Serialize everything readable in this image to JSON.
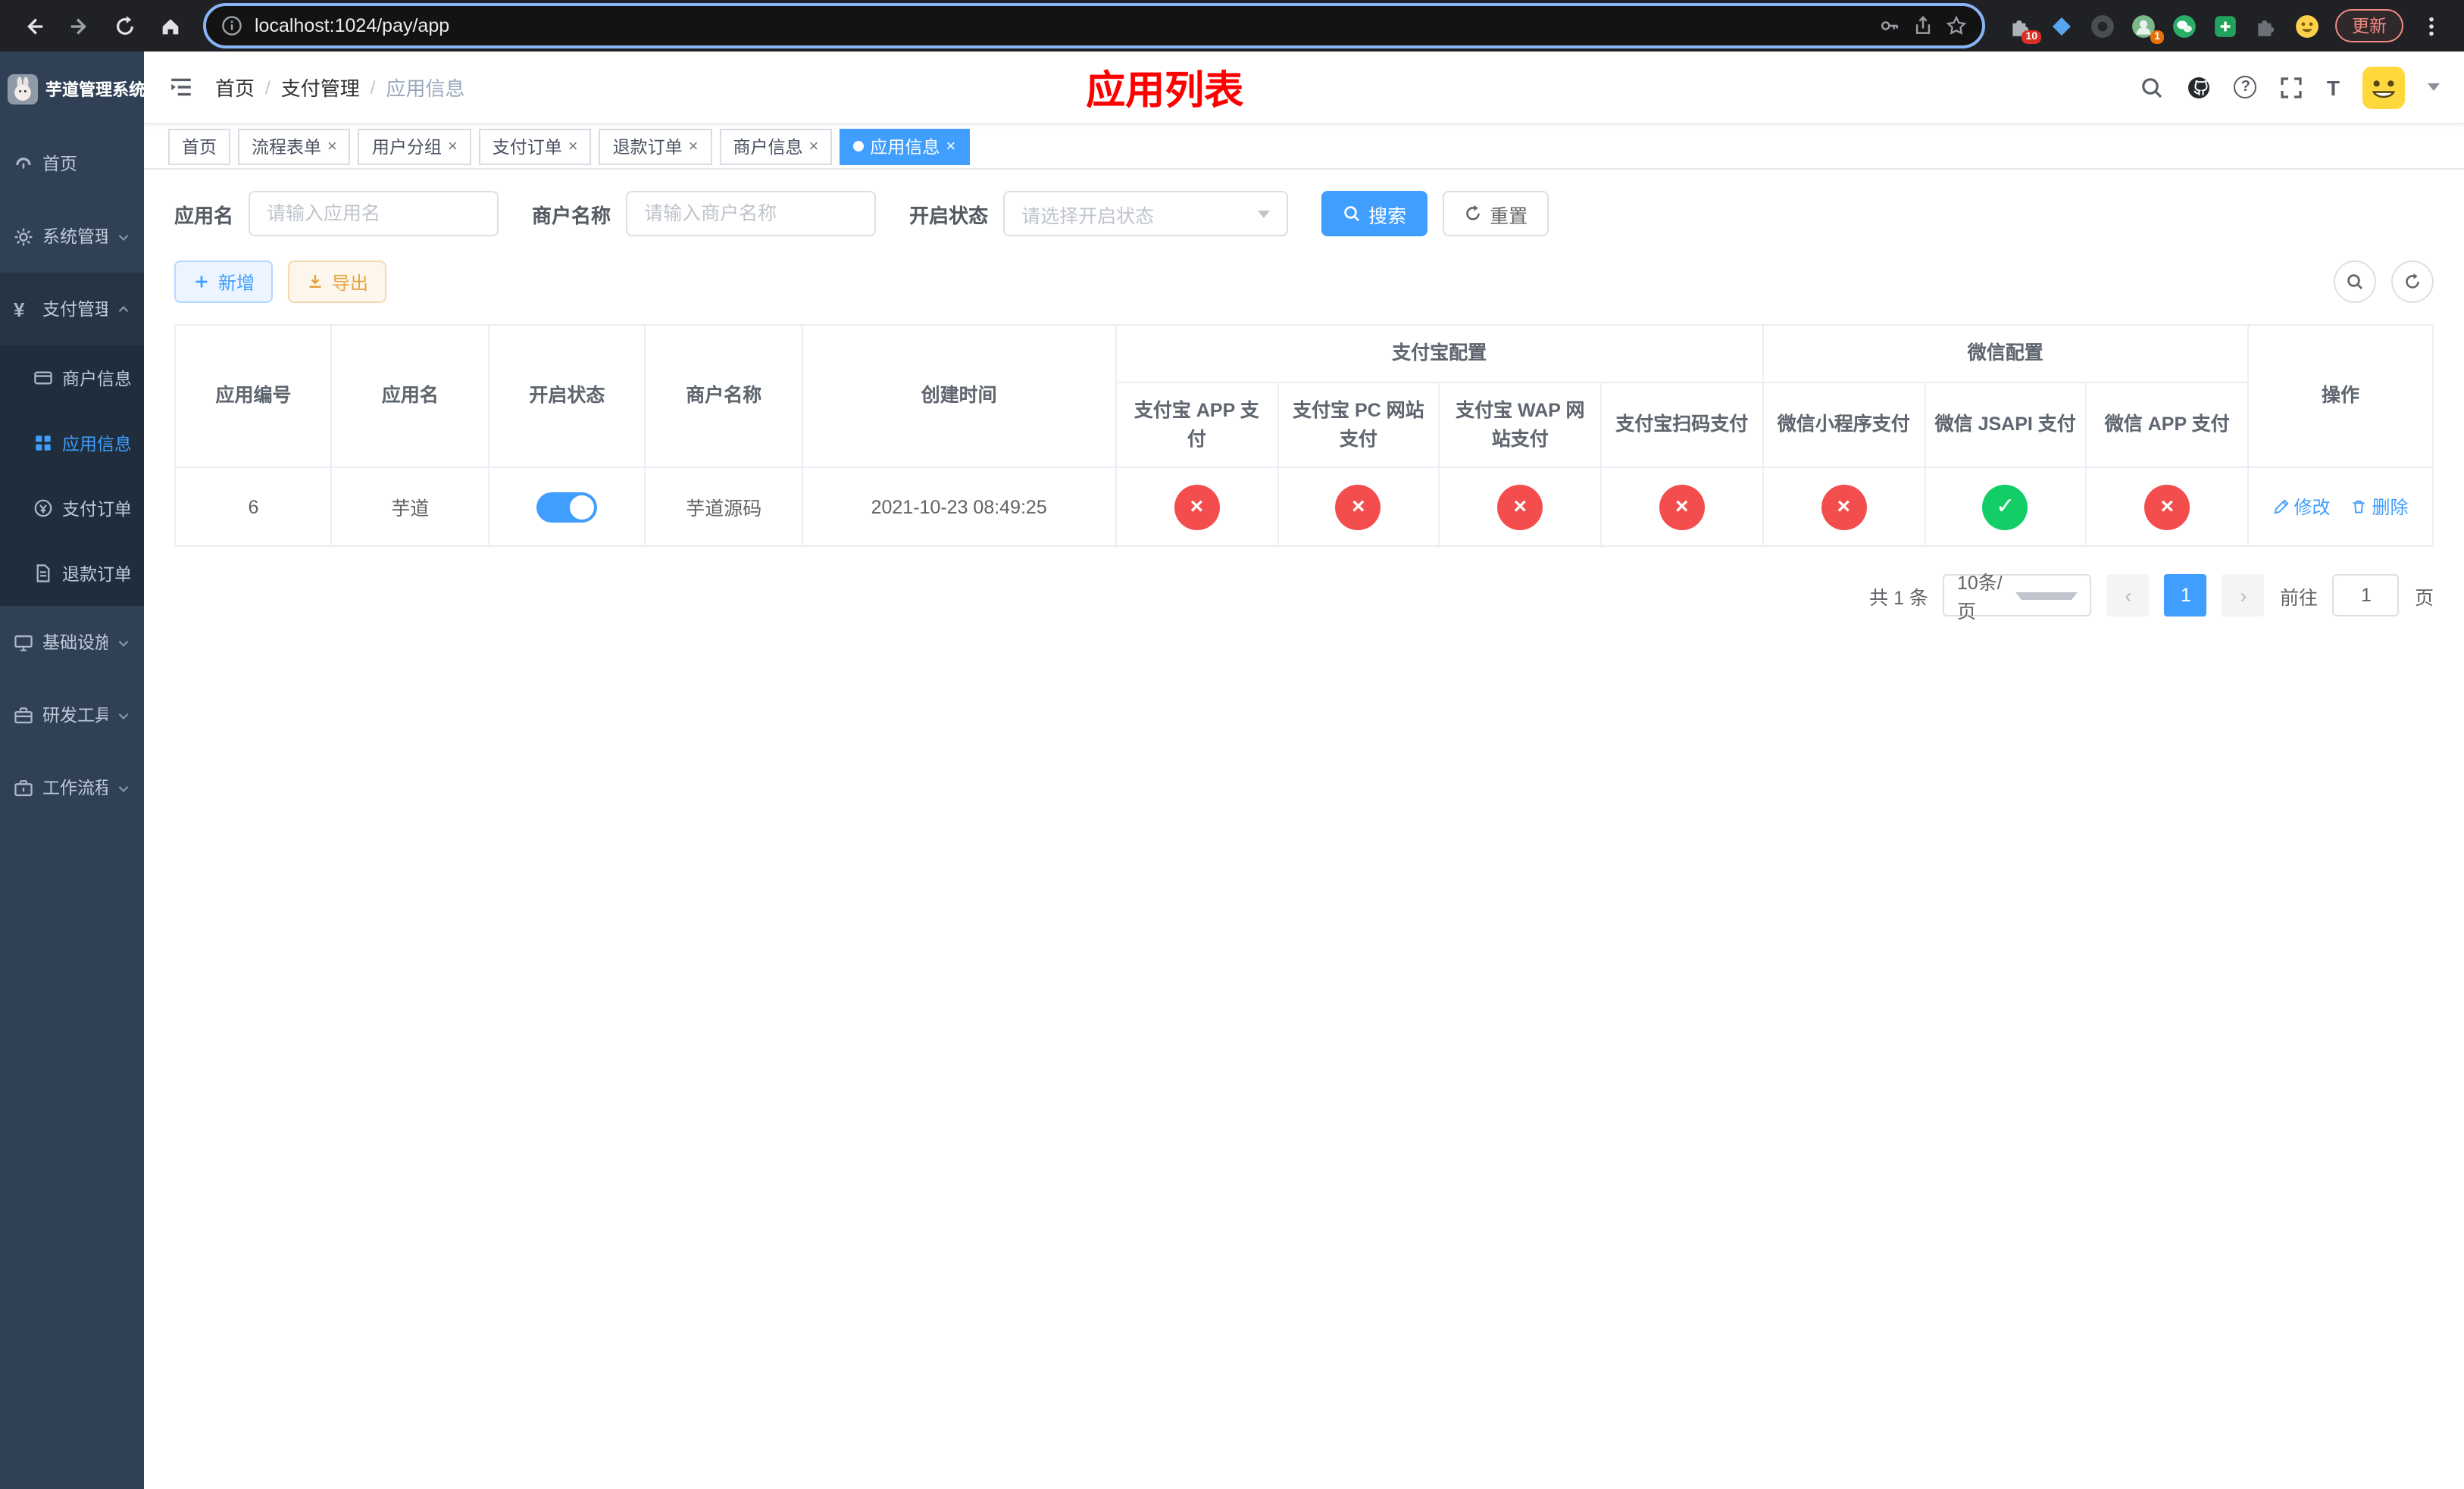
{
  "browser": {
    "url": "localhost:1024/pay/app",
    "update_label": "更新",
    "ext_badge_puzzle": "10",
    "ext_badge_avatar": "1"
  },
  "icons": {
    "close": "×",
    "check": "✓",
    "cross": "×",
    "question": "?",
    "font_size": "T"
  },
  "sidebar": {
    "logo_title": "芋道管理系统",
    "items": [
      {
        "label": "首页"
      },
      {
        "label": "系统管理"
      },
      {
        "label": "支付管理",
        "children": [
          {
            "label": "商户信息"
          },
          {
            "label": "应用信息"
          },
          {
            "label": "支付订单"
          },
          {
            "label": "退款订单"
          }
        ]
      },
      {
        "label": "基础设施"
      },
      {
        "label": "研发工具"
      },
      {
        "label": "工作流程"
      }
    ]
  },
  "header": {
    "breadcrumb": [
      "首页",
      "支付管理",
      "应用信息"
    ],
    "separator": "/",
    "page_title": "应用列表"
  },
  "tabs": [
    {
      "label": "首页"
    },
    {
      "label": "流程表单"
    },
    {
      "label": "用户分组"
    },
    {
      "label": "支付订单"
    },
    {
      "label": "退款订单"
    },
    {
      "label": "商户信息"
    },
    {
      "label": "应用信息"
    }
  ],
  "filters": {
    "app_name_label": "应用名",
    "app_name_placeholder": "请输入应用名",
    "merchant_label": "商户名称",
    "merchant_placeholder": "请输入商户名称",
    "status_label": "开启状态",
    "status_placeholder": "请选择开启状态",
    "search_label": "搜索",
    "reset_label": "重置"
  },
  "toolbar": {
    "add_label": "新增",
    "export_label": "导出"
  },
  "table": {
    "simple_columns": [
      "应用编号",
      "应用名",
      "开启状态",
      "商户名称",
      "创建时间"
    ],
    "alipay_group": {
      "label": "支付宝配置",
      "children": [
        "支付宝 APP 支付",
        "支付宝 PC 网站支付",
        "支付宝 WAP 网站支付",
        "支付宝扫码支付"
      ]
    },
    "wechat_group": {
      "label": "微信配置",
      "children": [
        "微信小程序支付",
        "微信 JSAPI 支付",
        "微信 APP 支付"
      ]
    },
    "ops_column": "操作",
    "rows": [
      {
        "app_id": "6",
        "app_name": "芋道",
        "enabled": true,
        "merchant_name": "芋道源码",
        "created_at": "2021-10-23 08:49:25",
        "status": {
          "alipay_app": false,
          "alipay_pc": false,
          "alipay_wap": false,
          "alipay_scan": false,
          "wechat_lite": false,
          "wechat_jsapi": true,
          "wechat_app": false
        },
        "edit_label": "修改",
        "delete_label": "删除"
      }
    ]
  },
  "pagination": {
    "total_text": "共 1 条",
    "page_size_text": "10条/页",
    "current_page": "1",
    "goto_prefix": "前往",
    "goto_value": "1",
    "goto_suffix": "页"
  },
  "colors": {
    "primary": "#409eff",
    "title_red": "#ff0000",
    "danger": "#f34d4d",
    "success": "#13ce66",
    "warning": "#e6a23c",
    "sidebar_bg": "#304156",
    "sidebar_sub_bg": "#1f2d3d"
  }
}
